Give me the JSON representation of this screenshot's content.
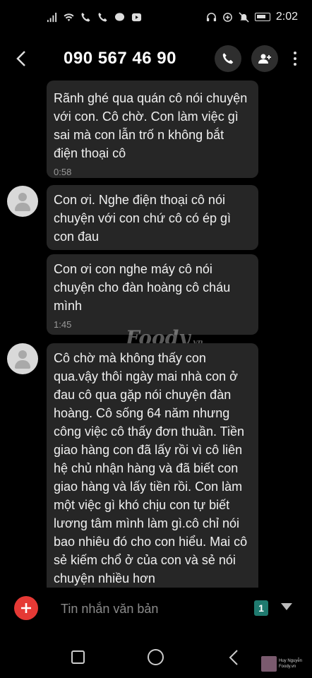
{
  "status_bar": {
    "time": "2:02"
  },
  "header": {
    "back_icon": "chevron-left-icon",
    "contact_number": "090 567 46 90"
  },
  "messages": [
    {
      "text": "Rãnh ghé qua quán cô nói chuyện với con. Cô chờ. Con làm việc gì sai mà con lẫn trố n không bắt điện thoại cô",
      "time": "0:58"
    },
    {
      "text": "Con ơi. Nghe điện thoại cô nói chuyện với  con chứ cô có ép gì con đau",
      "time": ""
    },
    {
      "text": "Con ơi con nghe máy cô nói chuyện cho đàn  hoàng cô cháu mình",
      "time": "1:45"
    },
    {
      "text": "Cô chờ mà không thấy con qua.vậy thôi ngày mai nhà con ở đau cô qua gặp nói chuyện đàn hoàng. Cô sống 64 năm nhưng công việc cô thấy đơn thuần. Tiền giao hàng con đã lấy rồi vì cô liên hệ chủ nhận hàng và đã biết con giao hàng và lấy tiền rồi. Con làm một việc gì khó chịu con tự biết lương tâm mình làm gì.cô chỉ nói bao nhiêu đó cho con hiểu. Mai cô sẻ kiếm chổ ở của con và sẻ nói chuyện nhiều hơn",
      "time": ""
    }
  ],
  "watermark": {
    "brand": "Foody",
    "suffix": ".vn"
  },
  "composer": {
    "placeholder": "Tin nhắn văn bản",
    "sim_slot": "1"
  },
  "corner_tag": {
    "line1": "Huy Nguyễn",
    "line2": "Foody.vn"
  }
}
